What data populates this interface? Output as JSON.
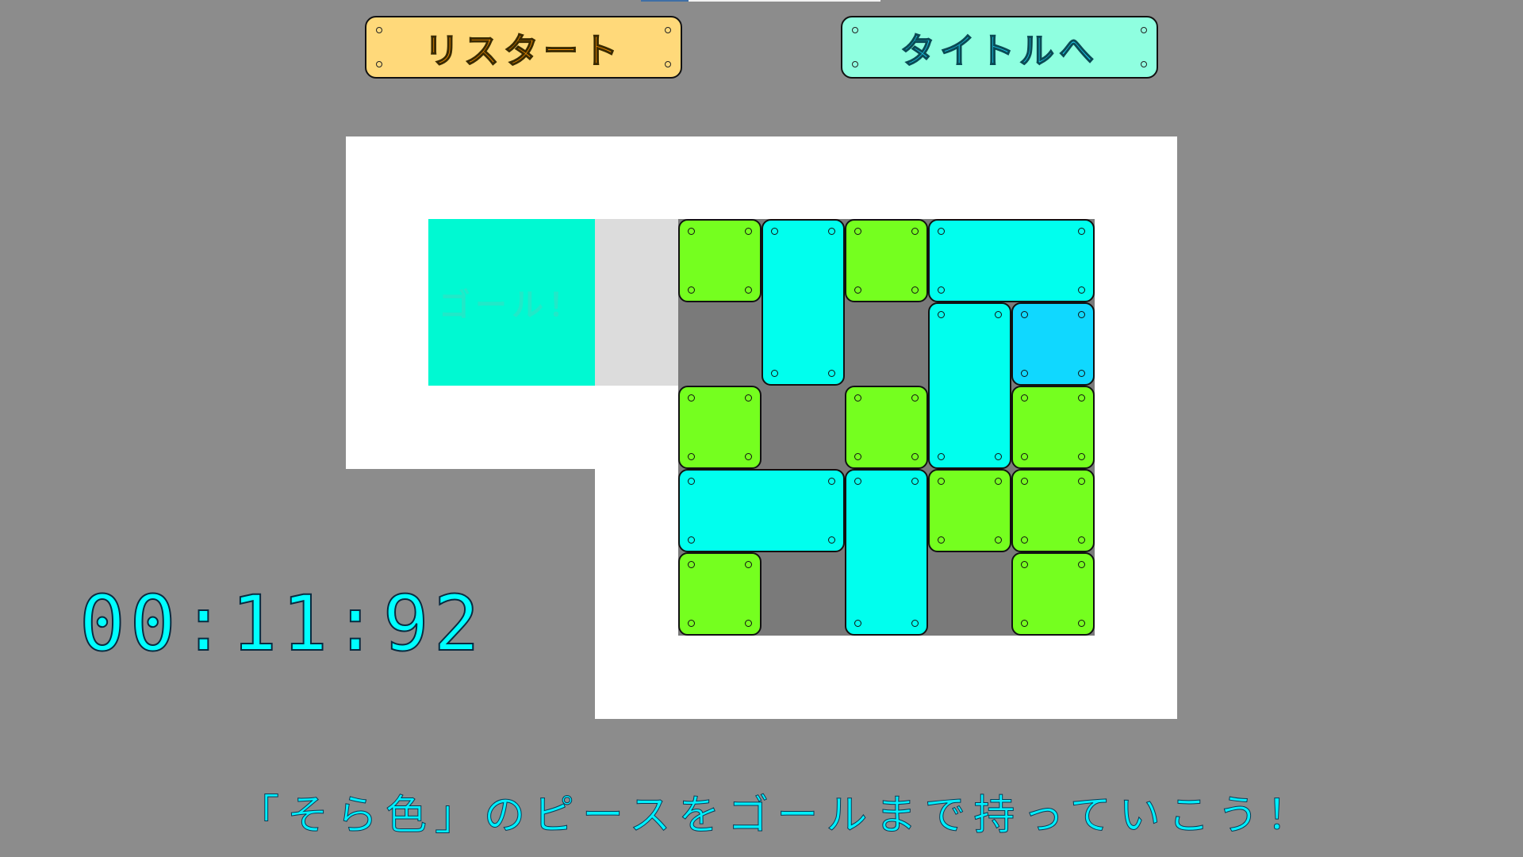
{
  "buttons": {
    "restart_label": "リスタート",
    "title_label": "タイトルへ"
  },
  "goal": {
    "label": "ゴール！"
  },
  "timer": {
    "value": "00:11:92"
  },
  "instruction": "「そら色」のピースをゴールまで持っていこう！",
  "colors": {
    "background": "#8c8c8c",
    "green_piece": "#75ff1f",
    "cyan_piece": "#00ffee",
    "target_piece": "#10d8ff",
    "goal": "#00f9d2",
    "timer": "#00ffff"
  }
}
